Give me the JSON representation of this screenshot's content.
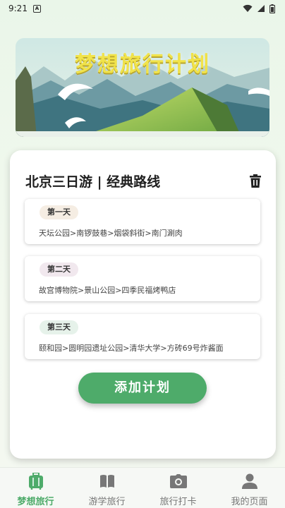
{
  "status_bar": {
    "time": "9:21"
  },
  "banner": {
    "title": "梦想旅行计划"
  },
  "plan": {
    "title": "北京三日游 | 经典路线",
    "days": [
      {
        "label": "第一天",
        "route": "天坛公园>南锣鼓巷>烟袋斜街>南门涮肉",
        "badge_color": "#f5ede3"
      },
      {
        "label": "第二天",
        "route": "故宫博物院>景山公园>四季民福烤鸭店",
        "badge_color": "#f1e8ee"
      },
      {
        "label": "第三天",
        "route": "颐和园>圆明园遗址公园>清华大学>方砖69号炸酱面",
        "badge_color": "#e6f2ea"
      }
    ],
    "add_label": "添加计划"
  },
  "tabbar": {
    "items": [
      {
        "label": "梦想旅行",
        "icon": "suitcase-icon",
        "active": true
      },
      {
        "label": "游学旅行",
        "icon": "book-icon",
        "active": false
      },
      {
        "label": "旅行打卡",
        "icon": "camera-icon",
        "active": false
      },
      {
        "label": "我的页面",
        "icon": "person-icon",
        "active": false
      }
    ]
  },
  "colors": {
    "accent": "#4eab6a",
    "inactive": "#777777"
  }
}
